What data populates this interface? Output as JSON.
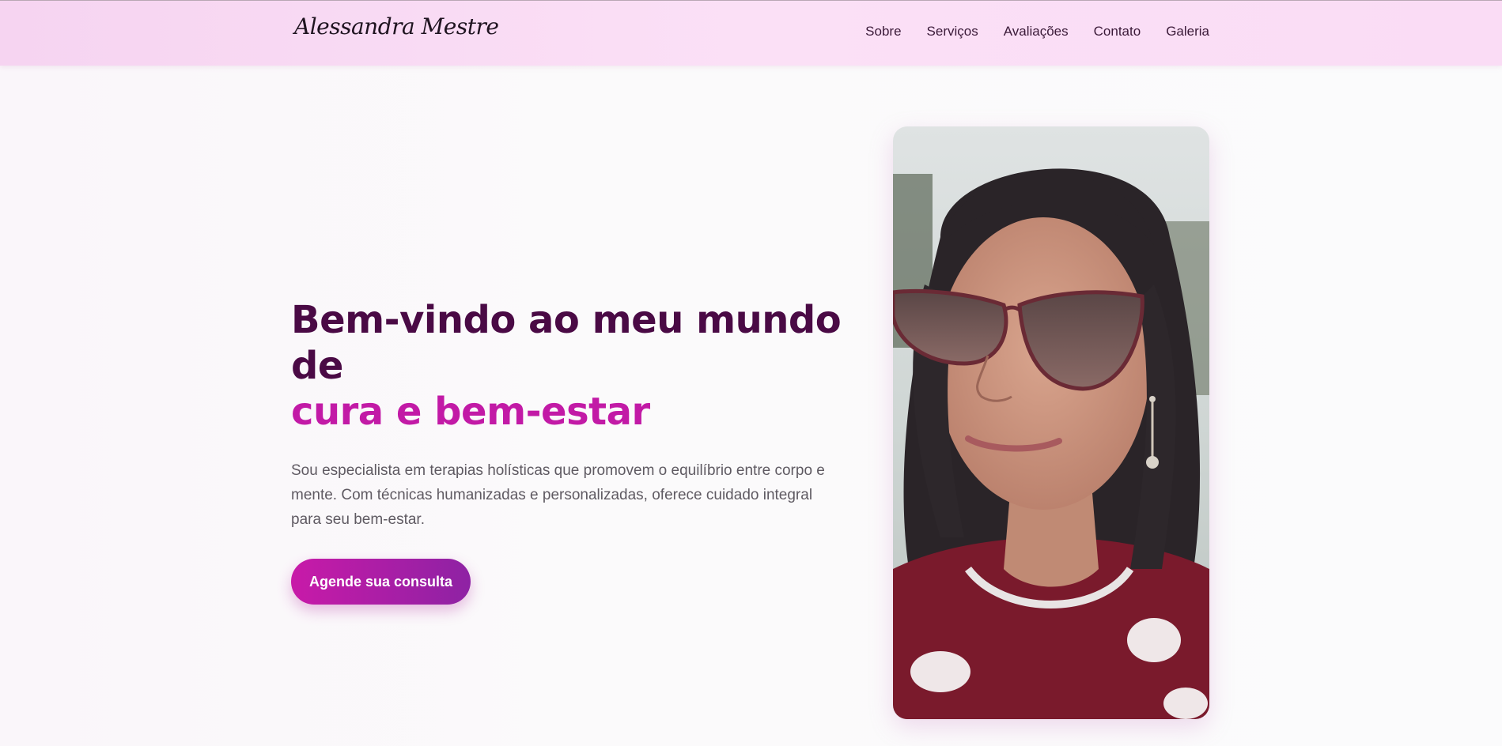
{
  "header": {
    "logo": "Alessandra Mestre",
    "nav": [
      "Sobre",
      "Serviços",
      "Avaliações",
      "Contato",
      "Galeria"
    ]
  },
  "hero": {
    "title_line1": "Bem-vindo ao meu mundo de",
    "title_line2": "cura e bem-estar",
    "description": "Sou especialista em terapias holísticas que promovem o equilíbrio entre corpo e mente. Com técnicas humanizadas e personalizadas, oferece cuidado integral para seu bem-estar.",
    "cta_label": "Agende sua consulta"
  },
  "colors": {
    "header_bg": "#f8d8f3",
    "title": "#4a0a45",
    "accent": "#c21aa6",
    "button_start": "#c81aa8",
    "button_end": "#8e22a4"
  }
}
